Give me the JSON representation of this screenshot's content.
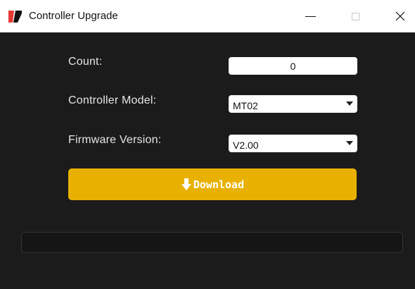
{
  "window": {
    "title": "Controller Upgrade",
    "controls": {
      "minimize": "minimize-icon",
      "maximize": "maximize-icon",
      "close": "close-icon"
    }
  },
  "form": {
    "count_label": "Count:",
    "count_value": "0",
    "model_label": "Controller Model:",
    "model_value": "MT02",
    "firmware_label": "Firmware Version:",
    "firmware_value": "V2.00"
  },
  "download": {
    "label": "Download",
    "icon": "download-arrow-icon"
  },
  "progress": {
    "value": 0
  },
  "colors": {
    "accent": "#e8b100",
    "background": "#1b1b1b",
    "logo_red": "#e53935"
  }
}
